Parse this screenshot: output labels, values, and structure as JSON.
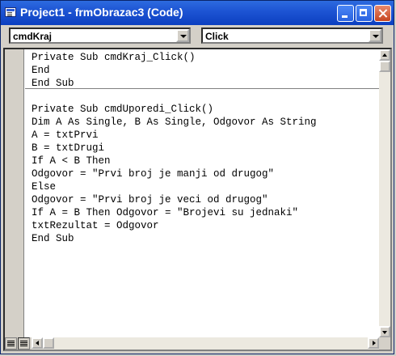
{
  "window": {
    "title": "Project1 - frmObrazac3 (Code)",
    "title_bar_color": "#0b3fc0",
    "buttons": [
      "minimize-icon",
      "maximize-icon",
      "close-icon"
    ]
  },
  "toolbar": {
    "object_combo": "cmdKraj",
    "procedure_combo": "Click"
  },
  "code": {
    "lines": [
      "Private Sub cmdKraj_Click()",
      "End",
      "End Sub",
      "",
      "Private Sub cmdUporedi_Click()",
      "Dim A As Single, B As Single, Odgovor As String",
      "A = txtPrvi",
      "B = txtDrugi",
      "If A < B Then",
      "Odgovor = \"Prvi broj je manji od drugog\"",
      "Else",
      "Odgovor = \"Prvi broj je veci od drugog\"",
      "If A = B Then Odgovor = \"Brojevi su jednaki\"",
      "txtRezultat = Odgovor",
      "End Sub"
    ]
  }
}
